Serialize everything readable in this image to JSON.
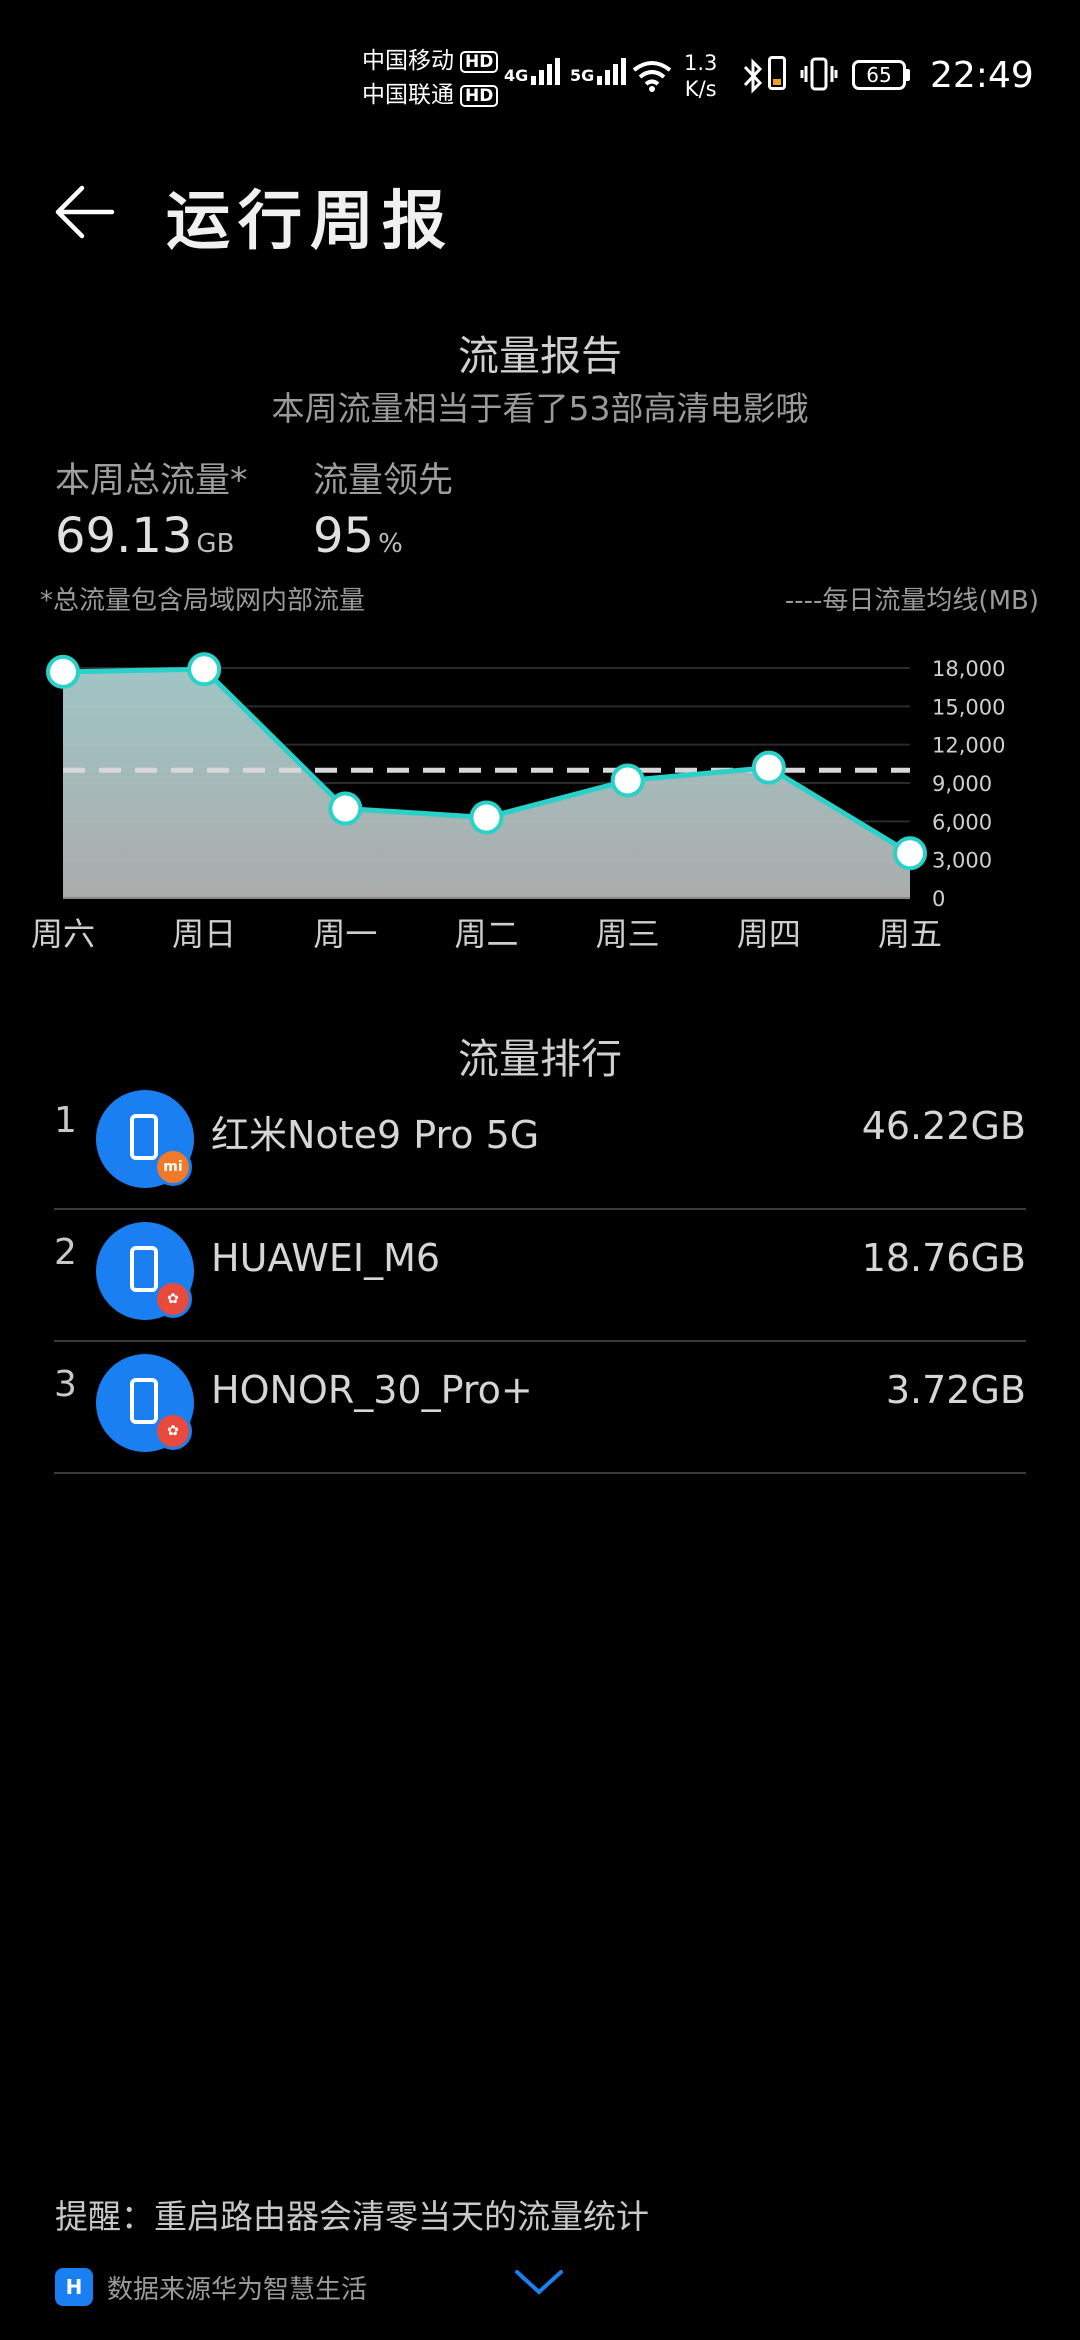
{
  "status_bar": {
    "carrier1": "中国移动",
    "carrier2": "中国联通",
    "hd": "HD",
    "net1": "4G",
    "net2": "5G",
    "speed_value": "1.3",
    "speed_unit": "K/s",
    "battery": "65",
    "time": "22:49"
  },
  "header": {
    "title": "运行周报"
  },
  "report": {
    "title": "流量报告",
    "subtitle": "本周流量相当于看了53部高清电影哦",
    "total_label": "本周总流量*",
    "total_value": "69.13",
    "total_unit": "GB",
    "lead_label": "流量领先",
    "lead_value": "95",
    "lead_unit": "%",
    "footnote": "*总流量包含局域网内部流量",
    "legend": "----每日流量均线(MB)"
  },
  "chart_data": {
    "type": "area",
    "x": [
      "周六",
      "周日",
      "周一",
      "周二",
      "周三",
      "周四",
      "周五"
    ],
    "series": [
      {
        "values": [
          17700,
          17900,
          7000,
          6300,
          9200,
          10200,
          3500
        ]
      }
    ],
    "average": 10000,
    "yticks": [
      "18,000",
      "15,000",
      "12,000",
      "9,000",
      "6,000",
      "3,000",
      "0"
    ],
    "ylim": [
      0,
      18000
    ],
    "line_color": "#2ad1c9",
    "avg_line_color": "#d8d8d8"
  },
  "ranking": {
    "title": "流量排行",
    "items": [
      {
        "rank": "1",
        "name": "红米Note9 Pro 5G",
        "value": "46.22GB",
        "badge": "mi",
        "badge_color": "#f07a2a"
      },
      {
        "rank": "2",
        "name": "HUAWEI_M6",
        "value": "18.76GB",
        "badge": "huawei",
        "badge_color": "#e84a3d"
      },
      {
        "rank": "3",
        "name": "HONOR_30_Pro+",
        "value": "3.72GB",
        "badge": "huawei",
        "badge_color": "#e84a3d"
      }
    ]
  },
  "footer": {
    "tip": "提醒：重启路由器会清零当天的流量统计",
    "source": "数据来源华为智慧生活"
  }
}
